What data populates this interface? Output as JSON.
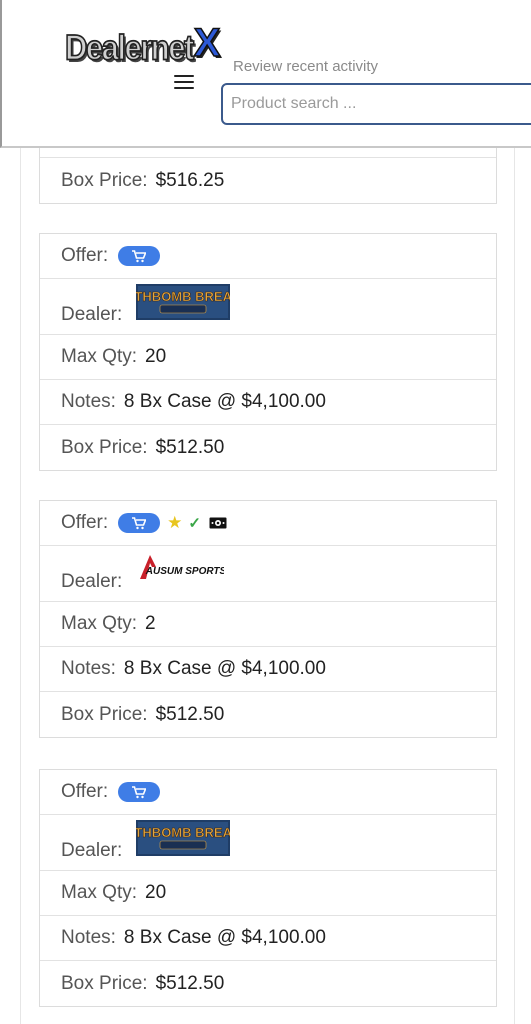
{
  "header": {
    "logo_main": "Dealernet",
    "logo_x": "X",
    "review_link": "Review recent activity",
    "search_placeholder": "Product search ..."
  },
  "labels": {
    "offer": "Offer:",
    "dealer": "Dealer:",
    "max_qty": "Max Qty:",
    "notes": "Notes:",
    "box_price": "Box Price:"
  },
  "partial_card": {
    "box_price": "$516.25"
  },
  "cards": [
    {
      "dealer": "FILTHBOMB BREAKS",
      "max_qty": "20",
      "notes": "8 Bx Case @ $4,100.00",
      "box_price": "$512.50"
    },
    {
      "dealer": "AUSUM SPORTS",
      "max_qty": "2",
      "notes": "8 Bx Case @ $4,100.00",
      "box_price": "$512.50",
      "badges": [
        "star-icon",
        "check-icon",
        "cash-icon"
      ]
    },
    {
      "dealer": "FILTHBOMB BREAKS",
      "max_qty": "20",
      "notes": "8 Bx Case @ $4,100.00",
      "box_price": "$512.50"
    }
  ],
  "colors": {
    "cart_button": "#3f7de6",
    "search_border": "#3b5a8c",
    "logo_x": "#2d59d6"
  }
}
